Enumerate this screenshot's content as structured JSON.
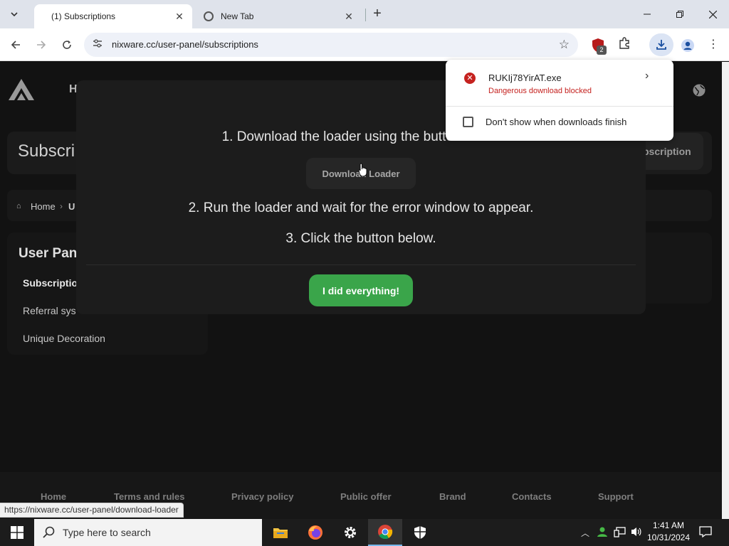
{
  "browser": {
    "tabs": [
      {
        "title": "(1) Subscriptions",
        "active": true
      },
      {
        "title": "New Tab",
        "active": false
      }
    ],
    "url": "nixware.cc/user-panel/subscriptions",
    "extension_badge": "2",
    "status_url": "https://nixware.cc/user-panel/download-loader"
  },
  "download_bubble": {
    "filename": "RUKIj78YirAT.exe",
    "status": "Dangerous download blocked",
    "checkbox_label": "Don't show when downloads finish",
    "checkbox_checked": false
  },
  "site": {
    "nav_partial": "H",
    "title_partial": "Subscri",
    "buy_button_partial": "bscription",
    "breadcrumb": {
      "home": "Home",
      "current_partial": "U"
    },
    "sidebar": {
      "title_partial": "User Pan",
      "items": [
        {
          "label": "Subscriptio",
          "active": true
        },
        {
          "label": "Referral sys",
          "active": false
        },
        {
          "label": "Unique Decoration",
          "active": false
        }
      ]
    },
    "footer_links": [
      "Home",
      "Terms and rules",
      "Privacy policy",
      "Public offer",
      "Brand",
      "Contacts",
      "Support"
    ]
  },
  "modal": {
    "step1": "1. Download the loader using the button below",
    "download_button": "Download Loader",
    "step2": "2. Run the loader and wait for the error window to appear.",
    "step3": "3. Click the button below.",
    "confirm_button": "I did everything!"
  },
  "taskbar": {
    "search_placeholder": "Type here to search",
    "time": "1:41 AM",
    "date": "10/31/2024"
  },
  "colors": {
    "accent_green": "#3aa54a",
    "danger_red": "#c5221f",
    "page_bg": "#121212"
  }
}
